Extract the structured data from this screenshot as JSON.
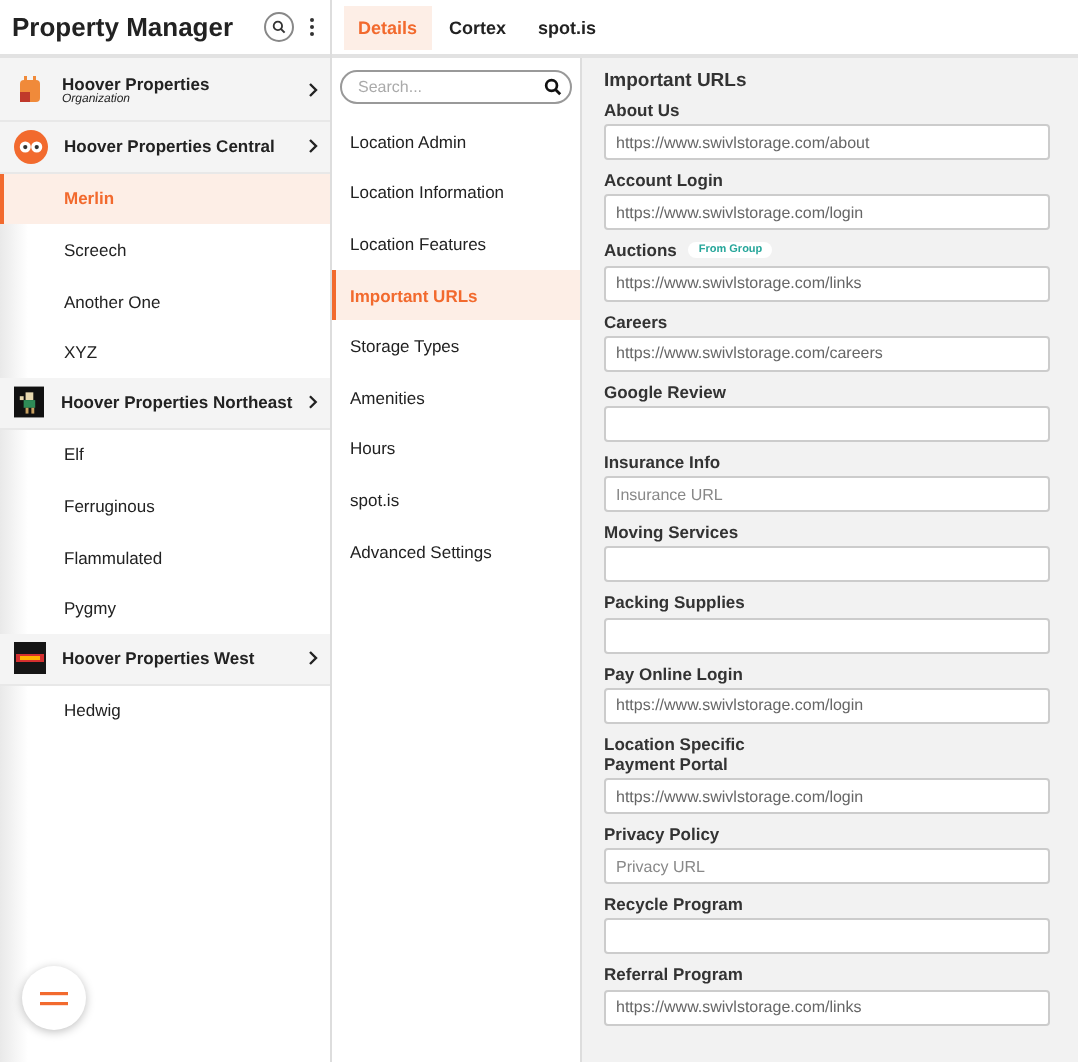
{
  "app_title": "Property Manager",
  "tabs": [
    {
      "label": "Details",
      "selected": true
    },
    {
      "label": "Cortex",
      "selected": false
    },
    {
      "label": "spot.is",
      "selected": false
    }
  ],
  "tree": [
    {
      "label": "Hoover Properties",
      "subtitle": "Organization"
    },
    {
      "label": "Hoover Properties Central",
      "children": [
        {
          "label": "Merlin",
          "selected": true
        },
        {
          "label": "Screech",
          "selected": false
        },
        {
          "label": "Another One",
          "selected": false
        },
        {
          "label": "XYZ",
          "selected": false
        }
      ]
    },
    {
      "label": "Hoover Properties Northeast",
      "children": [
        {
          "label": "Elf",
          "selected": false
        },
        {
          "label": "Ferruginous",
          "selected": false
        },
        {
          "label": "Flammulated",
          "selected": false
        },
        {
          "label": "Pygmy",
          "selected": false
        }
      ]
    },
    {
      "label": "Hoover Properties West",
      "children": [
        {
          "label": "Hedwig",
          "selected": false
        }
      ]
    }
  ],
  "section_search": {
    "placeholder": "Search..."
  },
  "sections": [
    {
      "label": "Location Admin",
      "selected": false
    },
    {
      "label": "Location Information",
      "selected": false
    },
    {
      "label": "Location Features",
      "selected": false
    },
    {
      "label": "Important URLs",
      "selected": true
    },
    {
      "label": "Storage Types",
      "selected": false
    },
    {
      "label": "Amenities",
      "selected": false
    },
    {
      "label": "Hours",
      "selected": false
    },
    {
      "label": "spot.is",
      "selected": false
    },
    {
      "label": "Advanced Settings",
      "selected": false
    }
  ],
  "form": {
    "title": "Important URLs",
    "fields": [
      {
        "label": "About Us",
        "value": "https://www.swivlstorage.com/about"
      },
      {
        "label": "Account Login",
        "value": "https://www.swivlstorage.com/login"
      },
      {
        "label": "Auctions",
        "badge": "From Group",
        "value": "https://www.swivlstorage.com/links"
      },
      {
        "label": "Careers",
        "value": "https://www.swivlstorage.com/careers"
      },
      {
        "label": "Google Review"
      },
      {
        "label": "Insurance Info",
        "placeholder": "Insurance URL"
      },
      {
        "label": "Moving Services"
      },
      {
        "label": "Packing Supplies"
      },
      {
        "label": "Pay Online Login",
        "value": "https://www.swivlstorage.com/login"
      },
      {
        "label": "Location Specific\nPayment Portal",
        "value": "https://www.swivlstorage.com/login"
      },
      {
        "label": "Privacy Policy",
        "placeholder": "Privacy URL"
      },
      {
        "label": "Recycle Program"
      },
      {
        "label": "Referral Program",
        "value": "https://www.swivlstorage.com/links"
      }
    ]
  }
}
